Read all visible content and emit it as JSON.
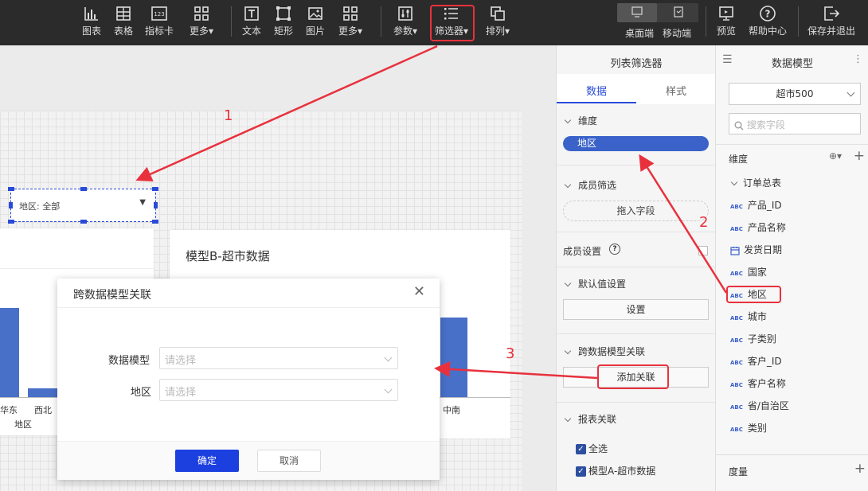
{
  "toolbar": {
    "items": [
      {
        "label": "图表",
        "icon": "bar-chart-icon"
      },
      {
        "label": "表格",
        "icon": "table-icon"
      },
      {
        "label": "指标卡",
        "icon": "kpi-card-icon"
      },
      {
        "label": "更多",
        "icon": "grid-more-icon"
      },
      {
        "label": "文本",
        "icon": "text-icon"
      },
      {
        "label": "矩形",
        "icon": "rectangle-icon"
      },
      {
        "label": "图片",
        "icon": "image-icon"
      },
      {
        "label": "更多",
        "icon": "grid-more-icon"
      },
      {
        "label": "参数",
        "icon": "sliders-icon"
      },
      {
        "label": "筛选器",
        "icon": "filter-list-icon"
      },
      {
        "label": "排列",
        "icon": "arrange-icon"
      }
    ],
    "view_desktop": "桌面端",
    "view_mobile": "移动端",
    "preview": "预览",
    "help": "帮助中心",
    "save_exit": "保存并退出"
  },
  "canvas": {
    "filter_text": "地区: 全部",
    "card_b_title": "模型B-超市数据",
    "chart_left": {
      "tick1": "华东",
      "tick2": "西北",
      "xlabel": "地区"
    },
    "chart_right": {
      "tick": "中南"
    }
  },
  "dialog": {
    "title": "跨数据模型关联",
    "field1_label": "数据模型",
    "field1_placeholder": "请选择",
    "field2_label": "地区",
    "field2_placeholder": "请选择",
    "ok": "确定",
    "cancel": "取消"
  },
  "panel": {
    "title": "列表筛选器",
    "tab_data": "数据",
    "tab_style": "样式",
    "dimension_label": "维度",
    "dimension_value": "地区",
    "member_filter": "成员筛选",
    "drag_field": "拖入字段",
    "member_setting": "成员设置",
    "default_setting": "默认值设置",
    "set_button": "设置",
    "cross_model": "跨数据模型关联",
    "add_link": "添加关联",
    "report_link": "报表关联",
    "select_all": "全选",
    "model_a": "模型A-超市数据"
  },
  "model": {
    "title": "数据模型",
    "dataset": "超市500",
    "search_placeholder": "搜索字段",
    "dimension": "维度",
    "table": "订单总表",
    "fields": [
      {
        "name": "产品_ID",
        "type": "ABC"
      },
      {
        "name": "产品名称",
        "type": "ABC"
      },
      {
        "name": "发货日期",
        "type": "date"
      },
      {
        "name": "国家",
        "type": "ABC"
      },
      {
        "name": "地区",
        "type": "ABC"
      },
      {
        "name": "城市",
        "type": "ABC"
      },
      {
        "name": "子类别",
        "type": "ABC"
      },
      {
        "name": "客户_ID",
        "type": "ABC"
      },
      {
        "name": "客户名称",
        "type": "ABC"
      },
      {
        "name": "省/自治区",
        "type": "ABC"
      },
      {
        "name": "类别",
        "type": "ABC"
      }
    ],
    "measure": "度量"
  },
  "annotations": {
    "n1": "1",
    "n2": "2",
    "n3": "3"
  },
  "colors": {
    "accent": "#3a5fcd",
    "annotation": "#e8313d",
    "toolbar": "#2b2b2b"
  }
}
